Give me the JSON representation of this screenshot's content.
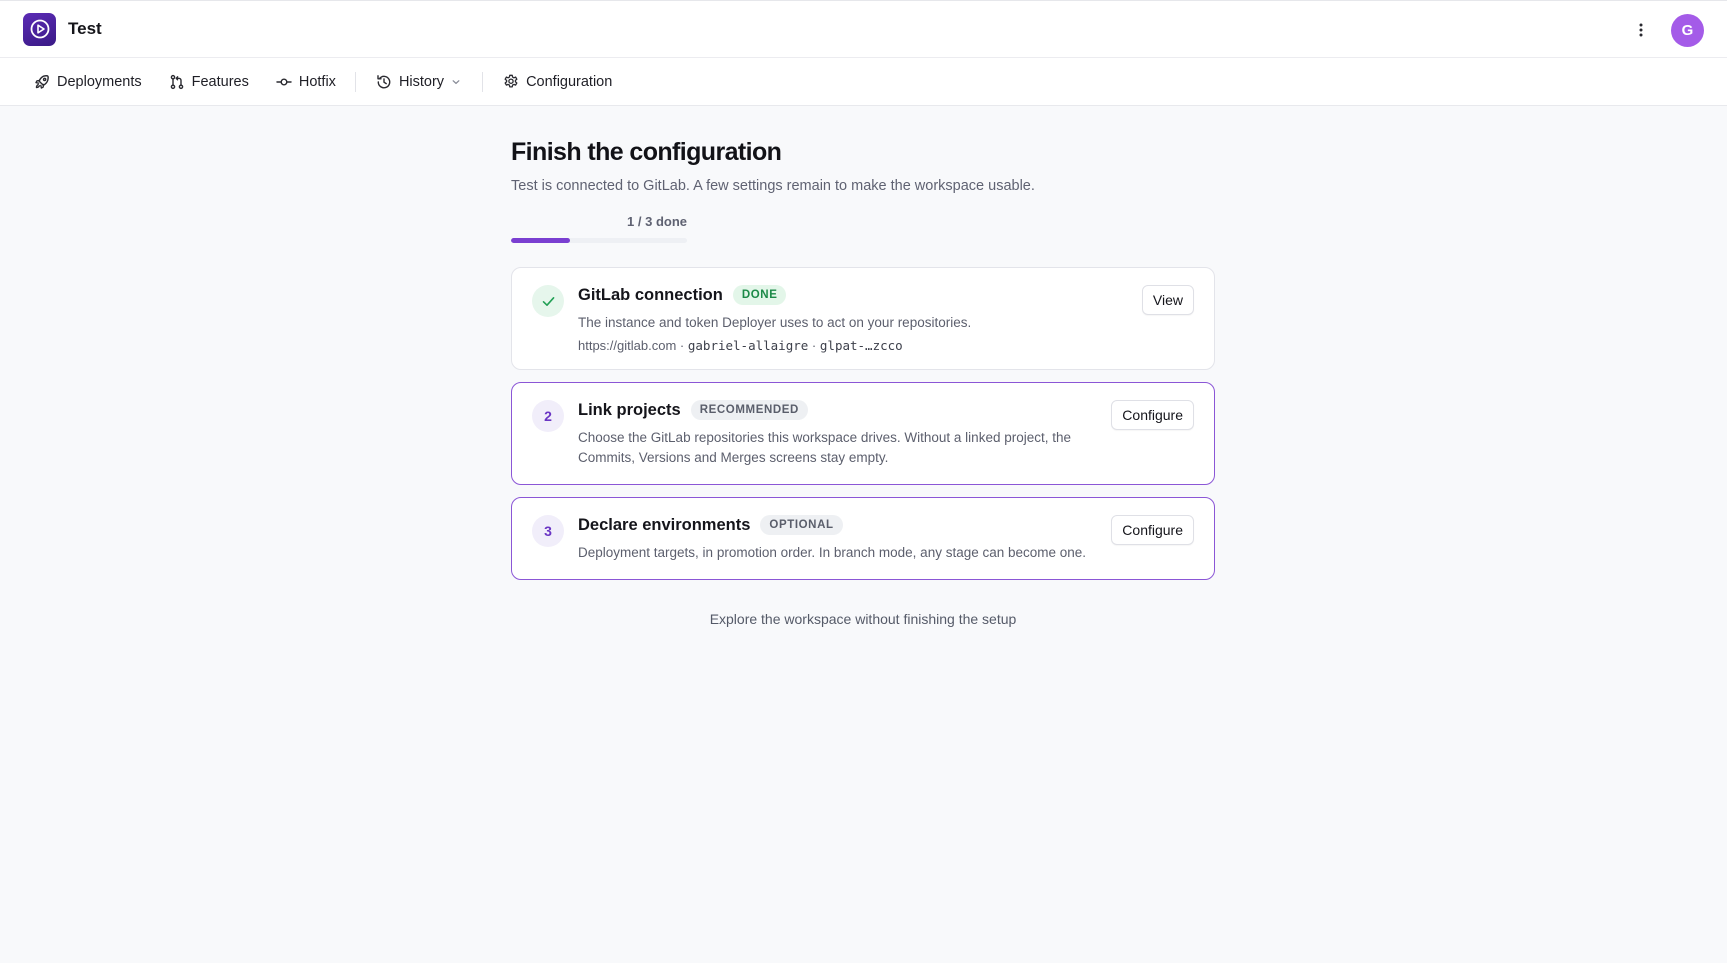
{
  "app": {
    "title": "Test",
    "avatar_initial": "G",
    "logo_icon": "play-icon",
    "accent_color": "#7a3fd1",
    "avatar_color": "#a45be8"
  },
  "nav": {
    "items": [
      {
        "label": "Deployments",
        "icon": "rocket-icon"
      },
      {
        "label": "Features",
        "icon": "git-pull-request-icon"
      },
      {
        "label": "Hotfix",
        "icon": "git-commit-icon"
      },
      {
        "label": "History",
        "icon": "history-icon",
        "has_dropdown": true
      },
      {
        "label": "Configuration",
        "icon": "gear-icon"
      }
    ]
  },
  "page": {
    "title": "Finish the configuration",
    "subtitle": "Test is connected to GitLab. A few settings remain to make the workspace usable.",
    "progress_label": "1 / 3 done",
    "progress_fraction": 0.333
  },
  "steps": [
    {
      "marker": "check-icon",
      "title": "GitLab connection",
      "badge": "DONE",
      "description": "The instance and token Deployer uses to act on your repositories.",
      "meta_url": "https://gitlab.com",
      "meta_separator": "·",
      "meta_user": "gabriel-allaigre",
      "meta_token": "glpat-…zcco",
      "button": "View"
    },
    {
      "marker": "2",
      "title": "Link projects",
      "badge": "RECOMMENDED",
      "description": "Choose the GitLab repositories this workspace drives. Without a linked project, the Commits, Versions and Merges screens stay empty.",
      "button": "Configure"
    },
    {
      "marker": "3",
      "title": "Declare environments",
      "badge": "OPTIONAL",
      "description": "Deployment targets, in promotion order. In branch mode, any stage can become one.",
      "button": "Configure"
    }
  ],
  "explore_link": "Explore the workspace without finishing the setup"
}
